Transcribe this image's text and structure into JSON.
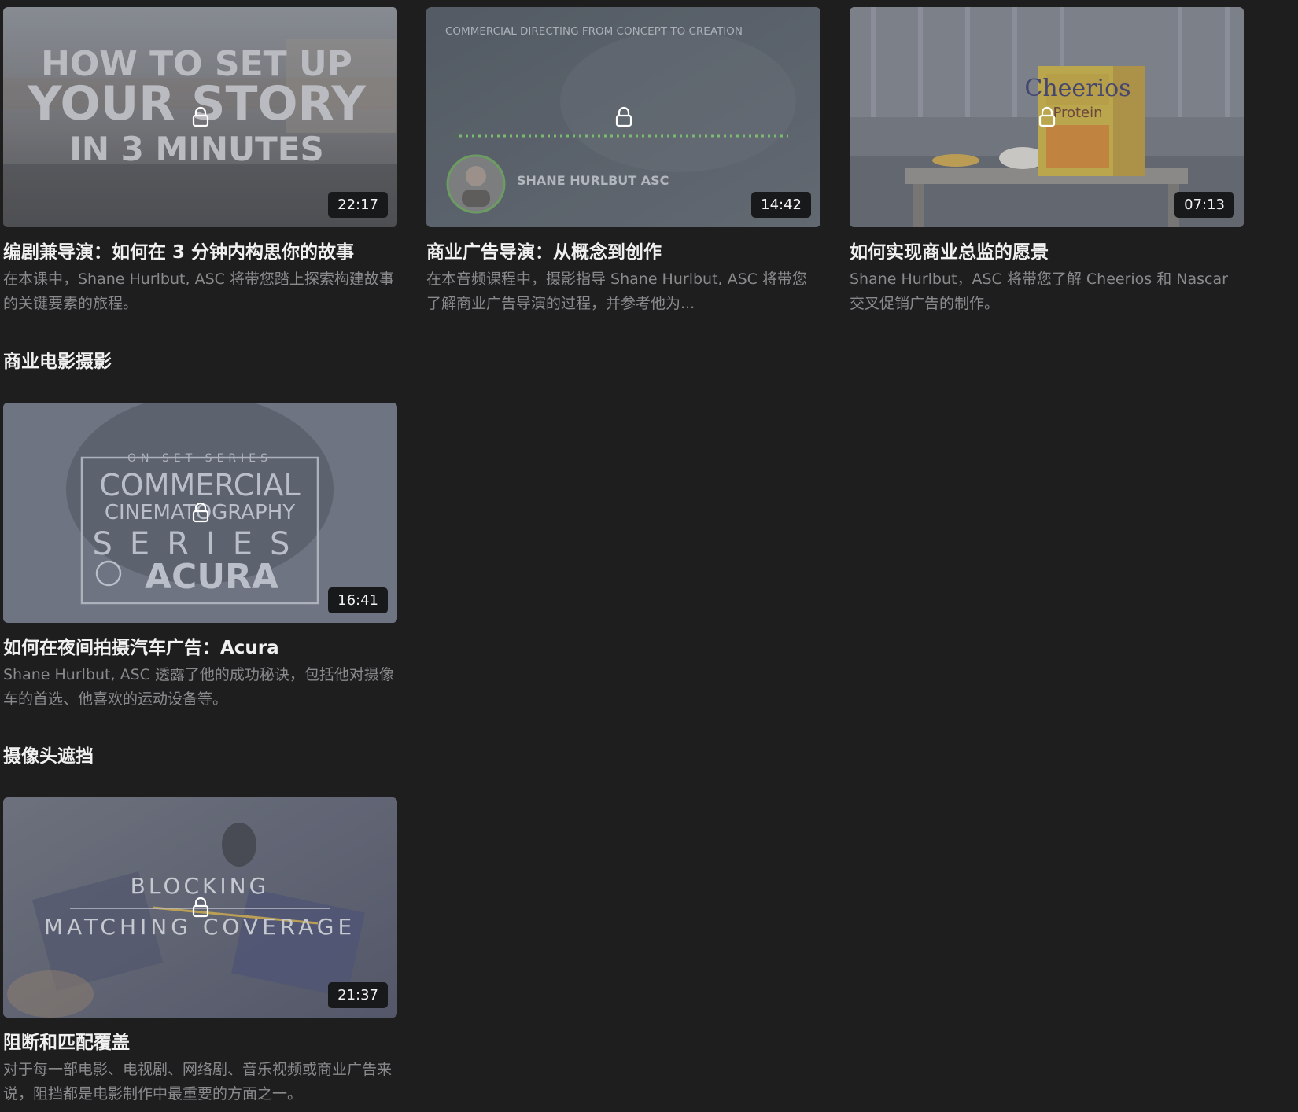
{
  "rows": [
    {
      "cards": [
        {
          "title": "编剧兼导演：如何在 3 分钟内构思你的故事",
          "description": "在本课中，Shane Hurlbut, ASC 将带您踏上探索构建故事的关键要素的旅程。",
          "duration": "22:17",
          "thumb_text": [
            "HOW TO SET UP",
            "YOUR STORY",
            "IN 3 MINUTES"
          ]
        },
        {
          "title": "商业广告导演：从概念到创作",
          "description": "在本音频课程中，摄影指导 Shane Hurlbut, ASC 将带您了解商业广告导演的过程，并参考他为...",
          "duration": "14:42",
          "thumb_text": [
            "COMMERCIAL DIRECTING FROM CONCEPT TO CREATION",
            "SHANE HURLBUT ASC"
          ]
        },
        {
          "title": "如何实现商业总监的愿景",
          "description": "Shane Hurlbut，ASC 将带您了解 Cheerios 和 Nascar 交叉促销广告的制作。",
          "duration": "07:13",
          "thumb_text": [
            "Cheerios",
            "Protein"
          ]
        }
      ]
    }
  ],
  "sections": [
    {
      "heading": "商业电影摄影",
      "cards": [
        {
          "title": "如何在夜间拍摄汽车广告：Acura",
          "description": "Shane Hurlbut, ASC 透露了他的成功秘诀，包括他对摄像车的首选、他喜欢的运动设备等。",
          "duration": "16:41",
          "thumb_text": [
            "ON SET SERIES",
            "COMMERCIAL",
            "CINEMATOGRAPHY",
            "SERIES",
            "ACURA"
          ]
        }
      ]
    },
    {
      "heading": "摄像头遮挡",
      "cards": [
        {
          "title": "阻断和匹配覆盖",
          "description": "对于每一部电影、电视剧、网络剧、音乐视频或商业广告来说，阻挡都是电影制作中最重要的方面之一。",
          "duration": "21:37",
          "thumb_text": [
            "BLOCKING",
            "MATCHING COVERAGE"
          ]
        }
      ]
    }
  ],
  "colors": {
    "background": "#1e1e1f",
    "title": "#f0f0f0",
    "description": "#8a8a8d",
    "duration_badge": "#18191b"
  },
  "icons": {
    "lock": "lock-icon"
  }
}
